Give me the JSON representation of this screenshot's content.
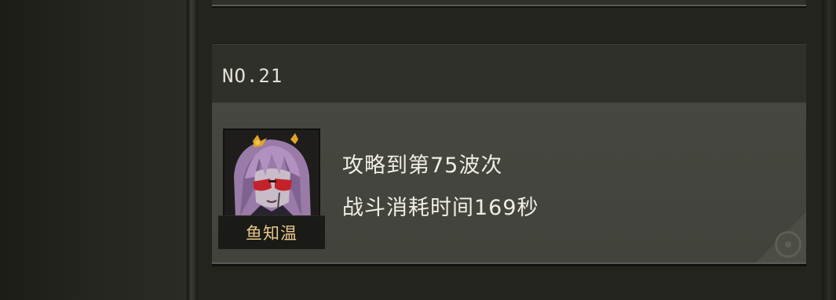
{
  "leaderboard": {
    "entry": {
      "rank_label": "NO.21",
      "player_name": "鱼知温",
      "avatar_icon": "purple-haired-character-portrait",
      "record_wave": "攻略到第75波次",
      "record_time": "战斗消耗时间169秒",
      "corner_icon": "radiation-icon"
    }
  },
  "colors": {
    "background": "#22231e",
    "card_header": "#2f302a",
    "card_body": "#45463f",
    "rank_text": "#e4e1d6",
    "name_text": "#e9c88a",
    "record_text": "#f0ede4"
  }
}
